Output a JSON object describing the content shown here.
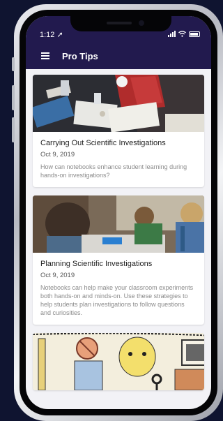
{
  "status_bar": {
    "time": "1:12 ➚"
  },
  "app_bar": {
    "menu_icon": "hamburger-menu-icon",
    "title": "Pro Tips"
  },
  "articles": [
    {
      "title": "Carrying Out Scientific Investigations",
      "date": "Oct 9, 2019",
      "excerpt": "How can notebooks enhance student learning during hands-on investigations?"
    },
    {
      "title": "Planning Scientific Investigations",
      "date": "Oct 9, 2019",
      "excerpt": "Notebooks can help make your classroom experiments both hands-on and minds-on. Use these strategies to help students plan investigations to follow questions and curiosities."
    }
  ],
  "colors": {
    "app_bar": "#221a4e",
    "page_background": "#0f1430",
    "feed_background": "#f2f2f6"
  }
}
